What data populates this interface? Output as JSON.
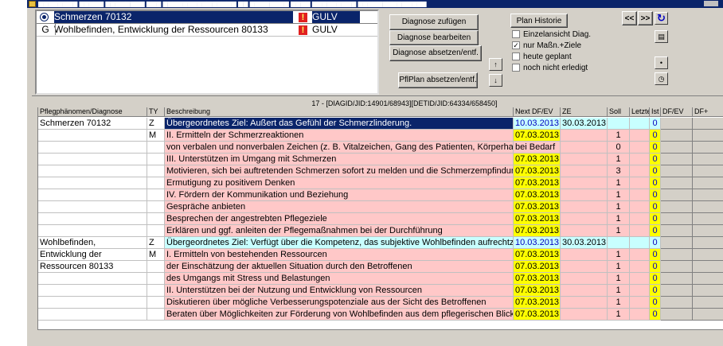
{
  "window": {
    "title_text": "▆▆▆▆▆▆▆▆ ▆▆▆▆▆ ▆▆▆▆▆▆▆▆ ▆▆▆ ▆▆▆▆▆▆▆▆▆▆▆▆▆▆▆ ▆▆ ▆▆▆▆▆▆▆▆ ▆▆▆▆ ▆▆▆▆▆▆▆▆▆ ▆▆▆▆▆▆▆▆▆▆▆▆▆▆"
  },
  "diagnoses": [
    {
      "code": "",
      "name": "Schmerzen 70132",
      "tag": "GULV",
      "selected": true
    },
    {
      "code": "G",
      "name": "Wohlbefinden, Entwicklung der Ressourcen 80133",
      "tag": "GULV",
      "selected": false
    }
  ],
  "buttons": {
    "add": "Diagnose zufügen",
    "edit": "Diagnose bearbeiten",
    "discontinue": "Diagnose absetzen/entf.",
    "plan_discontinue": "PflPlan absetzen/entf.",
    "history": "Plan Historie",
    "prev": "<<",
    "next": ">>"
  },
  "checkboxes": [
    {
      "label": "Einzelansicht Diag.",
      "checked": false
    },
    {
      "label": "nur Maßn.+Ziele",
      "checked": true
    },
    {
      "label": "heute geplant",
      "checked": false
    },
    {
      "label": "noch nicht erledigt",
      "checked": false
    }
  ],
  "grid": {
    "caption": "17 - [DIAGID/JID:14901/68943][DETID/JID:64334/658450]",
    "headers": [
      "Pflegphänomen/Diagnose",
      "TY",
      "Beschreibung",
      "Next DF/EV",
      "ZE",
      "Soll",
      "Letzte",
      "Ist",
      "DF/EV",
      "DF+"
    ],
    "rows": [
      {
        "diag": "Schmerzen 70132",
        "ty": "Z",
        "desc": "Übergeordnetes Ziel: Außert das Gefühl der Schmerzlinderung.",
        "next": "10.03.2013",
        "ze": "30.03.2013",
        "soll": "",
        "ist": "0",
        "kind": "goal-sel"
      },
      {
        "diag": "",
        "ty": "M",
        "desc": "II. Ermitteln der Schmerzreaktionen",
        "next": "07.03.2013",
        "ze": "",
        "soll": "1",
        "ist": "0",
        "kind": "m-y"
      },
      {
        "diag": "",
        "ty": "",
        "desc": "von verbalen und nonverbalen Zeichen (z. B. Vitalzeichen, Gang des Patienten, Körperhaltung)",
        "next": "bei Bedarf",
        "ze": "",
        "soll": "0",
        "ist": "0",
        "kind": "m-p"
      },
      {
        "diag": "",
        "ty": "",
        "desc": "III. Unterstützen im Umgang mit Schmerzen",
        "next": "07.03.2013",
        "ze": "",
        "soll": "1",
        "ist": "0",
        "kind": "m-y"
      },
      {
        "diag": "",
        "ty": "",
        "desc": "Motivieren, sich bei auftretenden Schmerzen sofort zu melden und die Schmerzempfindung zu beschreiben",
        "next": "07.03.2013",
        "ze": "",
        "soll": "3",
        "ist": "0",
        "kind": "m-y"
      },
      {
        "diag": "",
        "ty": "",
        "desc": "Ermutigung zu positivem Denken",
        "next": "07.03.2013",
        "ze": "",
        "soll": "1",
        "ist": "0",
        "kind": "m-y"
      },
      {
        "diag": "",
        "ty": "",
        "desc": "IV. Fördern der Kommunikation und Beziehung",
        "next": "07.03.2013",
        "ze": "",
        "soll": "1",
        "ist": "0",
        "kind": "m-y"
      },
      {
        "diag": "",
        "ty": "",
        "desc": "Gespräche anbieten",
        "next": "07.03.2013",
        "ze": "",
        "soll": "1",
        "ist": "0",
        "kind": "m-y"
      },
      {
        "diag": "",
        "ty": "",
        "desc": "Besprechen der angestrebten Pflegeziele",
        "next": "07.03.2013",
        "ze": "",
        "soll": "1",
        "ist": "0",
        "kind": "m-y"
      },
      {
        "diag": "",
        "ty": "",
        "desc": "Erklären und ggf. anleiten der Pflegemaßnahmen bei der Durchführung",
        "next": "07.03.2013",
        "ze": "",
        "soll": "1",
        "ist": "0",
        "kind": "m-y"
      },
      {
        "diag": "Wohlbefinden,",
        "ty": "Z",
        "desc": "Übergeordnetes Ziel: Verfügt über die Kompetenz, das subjektive Wohlbefinden aufrechtzuerhalten",
        "next": "10.03.2013",
        "ze": "30.03.2013",
        "soll": "",
        "ist": "0",
        "kind": "goal"
      },
      {
        "diag": "Entwicklung der",
        "ty": "M",
        "desc": "I. Ermitteln von bestehenden Ressourcen",
        "next": "07.03.2013",
        "ze": "",
        "soll": "1",
        "ist": "0",
        "kind": "m-y"
      },
      {
        "diag": "Ressourcen 80133",
        "ty": "",
        "desc": "der Einschätzung der aktuellen Situation durch den Betroffenen",
        "next": "07.03.2013",
        "ze": "",
        "soll": "1",
        "ist": "0",
        "kind": "m-y"
      },
      {
        "diag": "",
        "ty": "",
        "desc": "des Umgangs mit Stress und Belastungen",
        "next": "07.03.2013",
        "ze": "",
        "soll": "1",
        "ist": "0",
        "kind": "m-y"
      },
      {
        "diag": "",
        "ty": "",
        "desc": "II. Unterstützen bei der Nutzung und Entwicklung von Ressourcen",
        "next": "07.03.2013",
        "ze": "",
        "soll": "1",
        "ist": "0",
        "kind": "m-y"
      },
      {
        "diag": "",
        "ty": "",
        "desc": "Diskutieren über mögliche Verbesserungspotenziale aus der Sicht des Betroffenen",
        "next": "07.03.2013",
        "ze": "",
        "soll": "1",
        "ist": "0",
        "kind": "m-y"
      },
      {
        "diag": "",
        "ty": "",
        "desc": "Beraten über Möglichkeiten zur Förderung von Wohlbefinden aus dem pflegerischen Blickwinkel",
        "next": "07.03.2013",
        "ze": "",
        "soll": "1",
        "ist": "0",
        "kind": "m-y"
      }
    ]
  },
  "colors": {
    "selected": "#0a246a",
    "goal": "#c8ffff",
    "measure": "#ffc8c8",
    "date": "#ffff00",
    "warn": "#e02020"
  }
}
